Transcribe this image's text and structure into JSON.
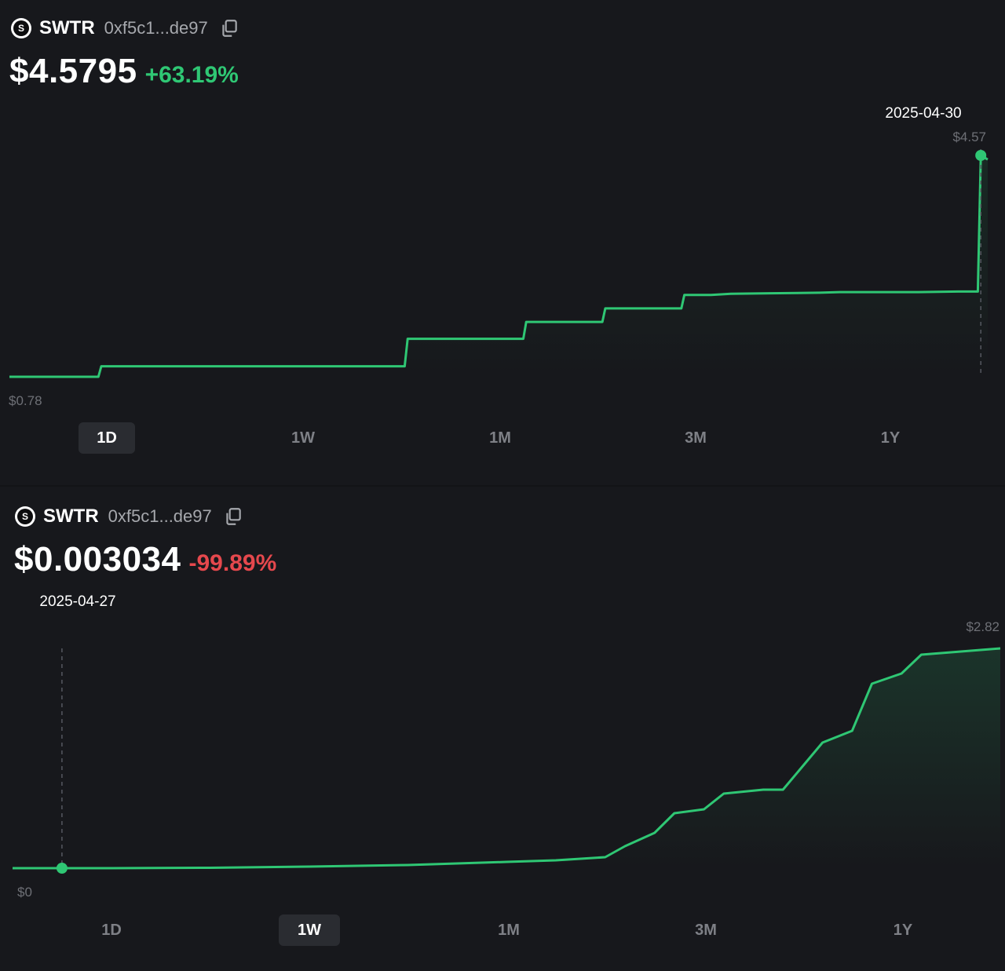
{
  "colors": {
    "background": "#17181c",
    "line": "#2fc774",
    "positive": "#2fc774",
    "negative": "#e5484d",
    "muted": "#6e7076"
  },
  "panels": [
    {
      "token": {
        "badge_letter": "S",
        "symbol": "SWTR",
        "address": "0xf5c1...de97",
        "copy_icon": "copy-icon"
      },
      "price": "$4.5795",
      "change": "+63.19%",
      "change_direction": "up",
      "hover_date": "2025-04-30",
      "max_label": "$4.57",
      "min_label": "$0.78",
      "ranges": [
        "1D",
        "1W",
        "1M",
        "3M",
        "1Y"
      ],
      "active_range": "1D"
    },
    {
      "token": {
        "badge_letter": "S",
        "symbol": "SWTR",
        "address": "0xf5c1...de97",
        "copy_icon": "copy-icon"
      },
      "price": "$0.003034",
      "change": "-99.89%",
      "change_direction": "down",
      "hover_date": "2025-04-27",
      "max_label": "$2.82",
      "min_label": "$0",
      "ranges": [
        "1D",
        "1W",
        "1M",
        "3M",
        "1Y"
      ],
      "active_range": "1W"
    }
  ],
  "chart_data": [
    {
      "type": "line",
      "range": "1D",
      "ylim": [
        0.78,
        4.57
      ],
      "x": [
        0,
        4,
        9,
        9.3,
        16,
        21,
        25,
        36,
        40,
        40.3,
        45,
        52,
        52.3,
        58,
        60,
        60.3,
        65,
        68,
        68.3,
        71,
        73,
        77,
        82,
        84,
        88,
        92,
        96,
        98,
        98.3,
        99
      ],
      "values": [
        0.78,
        0.78,
        0.78,
        0.96,
        0.96,
        0.96,
        0.96,
        0.96,
        0.96,
        1.43,
        1.43,
        1.43,
        1.72,
        1.72,
        1.72,
        1.95,
        1.95,
        1.95,
        2.18,
        2.18,
        2.2,
        2.21,
        2.22,
        2.23,
        2.23,
        2.23,
        2.24,
        2.24,
        4.57,
        4.5
      ],
      "highlight_index": 28,
      "grid": false,
      "legend": "none"
    },
    {
      "type": "area",
      "range": "1W",
      "ylim": [
        0,
        2.82
      ],
      "x": [
        0,
        5,
        10,
        20,
        30,
        40,
        45,
        50,
        55,
        60,
        62,
        65,
        67,
        70,
        72,
        76,
        78,
        82,
        85,
        87,
        90,
        92,
        95,
        100
      ],
      "values": [
        0.0,
        0.0,
        0.0,
        0.005,
        0.02,
        0.04,
        0.06,
        0.08,
        0.1,
        0.14,
        0.28,
        0.45,
        0.7,
        0.75,
        0.95,
        1.0,
        1.0,
        1.6,
        1.75,
        2.35,
        2.48,
        2.72,
        2.75,
        2.8
      ],
      "highlight_index": 1,
      "grid": false,
      "legend": "none"
    }
  ]
}
